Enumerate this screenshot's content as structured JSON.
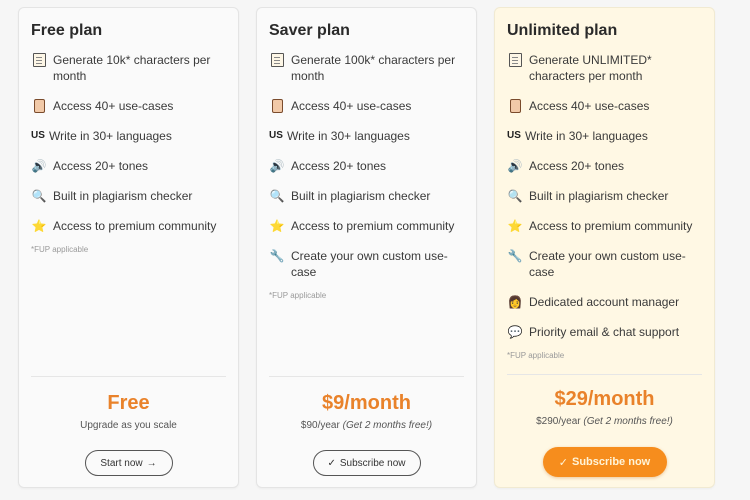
{
  "plans": [
    {
      "title": "Free plan",
      "features": [
        {
          "icon": "memo-icon",
          "text": "Generate 10k* characters per month"
        },
        {
          "icon": "scroll-icon",
          "text": "Access 40+ use-cases"
        },
        {
          "icon": "us-flag-icon",
          "glyph": "US",
          "text": "Write in 30+ languages"
        },
        {
          "icon": "speaker-icon",
          "glyph": "🔊",
          "text": "Access 20+ tones"
        },
        {
          "icon": "magnifier-icon",
          "glyph": "🔍",
          "text": "Built in plagiarism checker"
        },
        {
          "icon": "star-icon",
          "glyph": "⭐",
          "text": "Access to premium community"
        }
      ],
      "fup": "*FUP applicable",
      "price": "Free",
      "subtitle": "Upgrade as you scale",
      "subtitle_note": "",
      "button": {
        "label": "Start now",
        "icon": "arrow-right-icon",
        "glyph": "→"
      }
    },
    {
      "title": "Saver plan",
      "features": [
        {
          "icon": "memo-icon",
          "text": "Generate 100k* characters per month"
        },
        {
          "icon": "scroll-icon",
          "text": "Access 40+ use-cases"
        },
        {
          "icon": "us-flag-icon",
          "glyph": "US",
          "text": "Write in 30+ languages"
        },
        {
          "icon": "speaker-icon",
          "glyph": "🔊",
          "text": "Access 20+ tones"
        },
        {
          "icon": "magnifier-icon",
          "glyph": "🔍",
          "text": "Built in plagiarism checker"
        },
        {
          "icon": "star-icon",
          "glyph": "⭐",
          "text": "Access to premium community"
        },
        {
          "icon": "wrench-icon",
          "glyph": "🔧",
          "text": "Create your own custom use-case"
        }
      ],
      "fup": "*FUP applicable",
      "price": "$9/month",
      "subtitle": "$90/year",
      "subtitle_note": "(Get 2 months free!)",
      "button": {
        "label": "Subscribe now",
        "icon": "check-icon",
        "glyph": "✓"
      }
    },
    {
      "title": "Unlimited plan",
      "features": [
        {
          "icon": "memo-icon",
          "text": "Generate UNLIMITED* characters per month"
        },
        {
          "icon": "scroll-icon",
          "text": "Access 40+ use-cases"
        },
        {
          "icon": "us-flag-icon",
          "glyph": "US",
          "text": "Write in 30+ languages"
        },
        {
          "icon": "speaker-icon",
          "glyph": "🔊",
          "text": "Access 20+ tones"
        },
        {
          "icon": "magnifier-icon",
          "glyph": "🔍",
          "text": "Built in plagiarism checker"
        },
        {
          "icon": "star-icon",
          "glyph": "⭐",
          "text": "Access to premium community"
        },
        {
          "icon": "wrench-icon",
          "glyph": "🔧",
          "text": "Create your own custom use-case"
        },
        {
          "icon": "account-manager-icon",
          "glyph": "👩",
          "text": "Dedicated account manager"
        },
        {
          "icon": "chat-bubble-icon",
          "glyph": "💬",
          "text": "Priority email & chat support"
        }
      ],
      "fup": "*FUP applicable",
      "price": "$29/month",
      "subtitle": "$290/year",
      "subtitle_note": "(Get 2 months free!)",
      "button": {
        "label": "Subscribe now",
        "icon": "check-icon",
        "glyph": "✓"
      }
    }
  ],
  "colors": {
    "accent": "#e9822a",
    "primary_button": "#f68d1d",
    "highlight_card_bg": "#fff8e4"
  }
}
